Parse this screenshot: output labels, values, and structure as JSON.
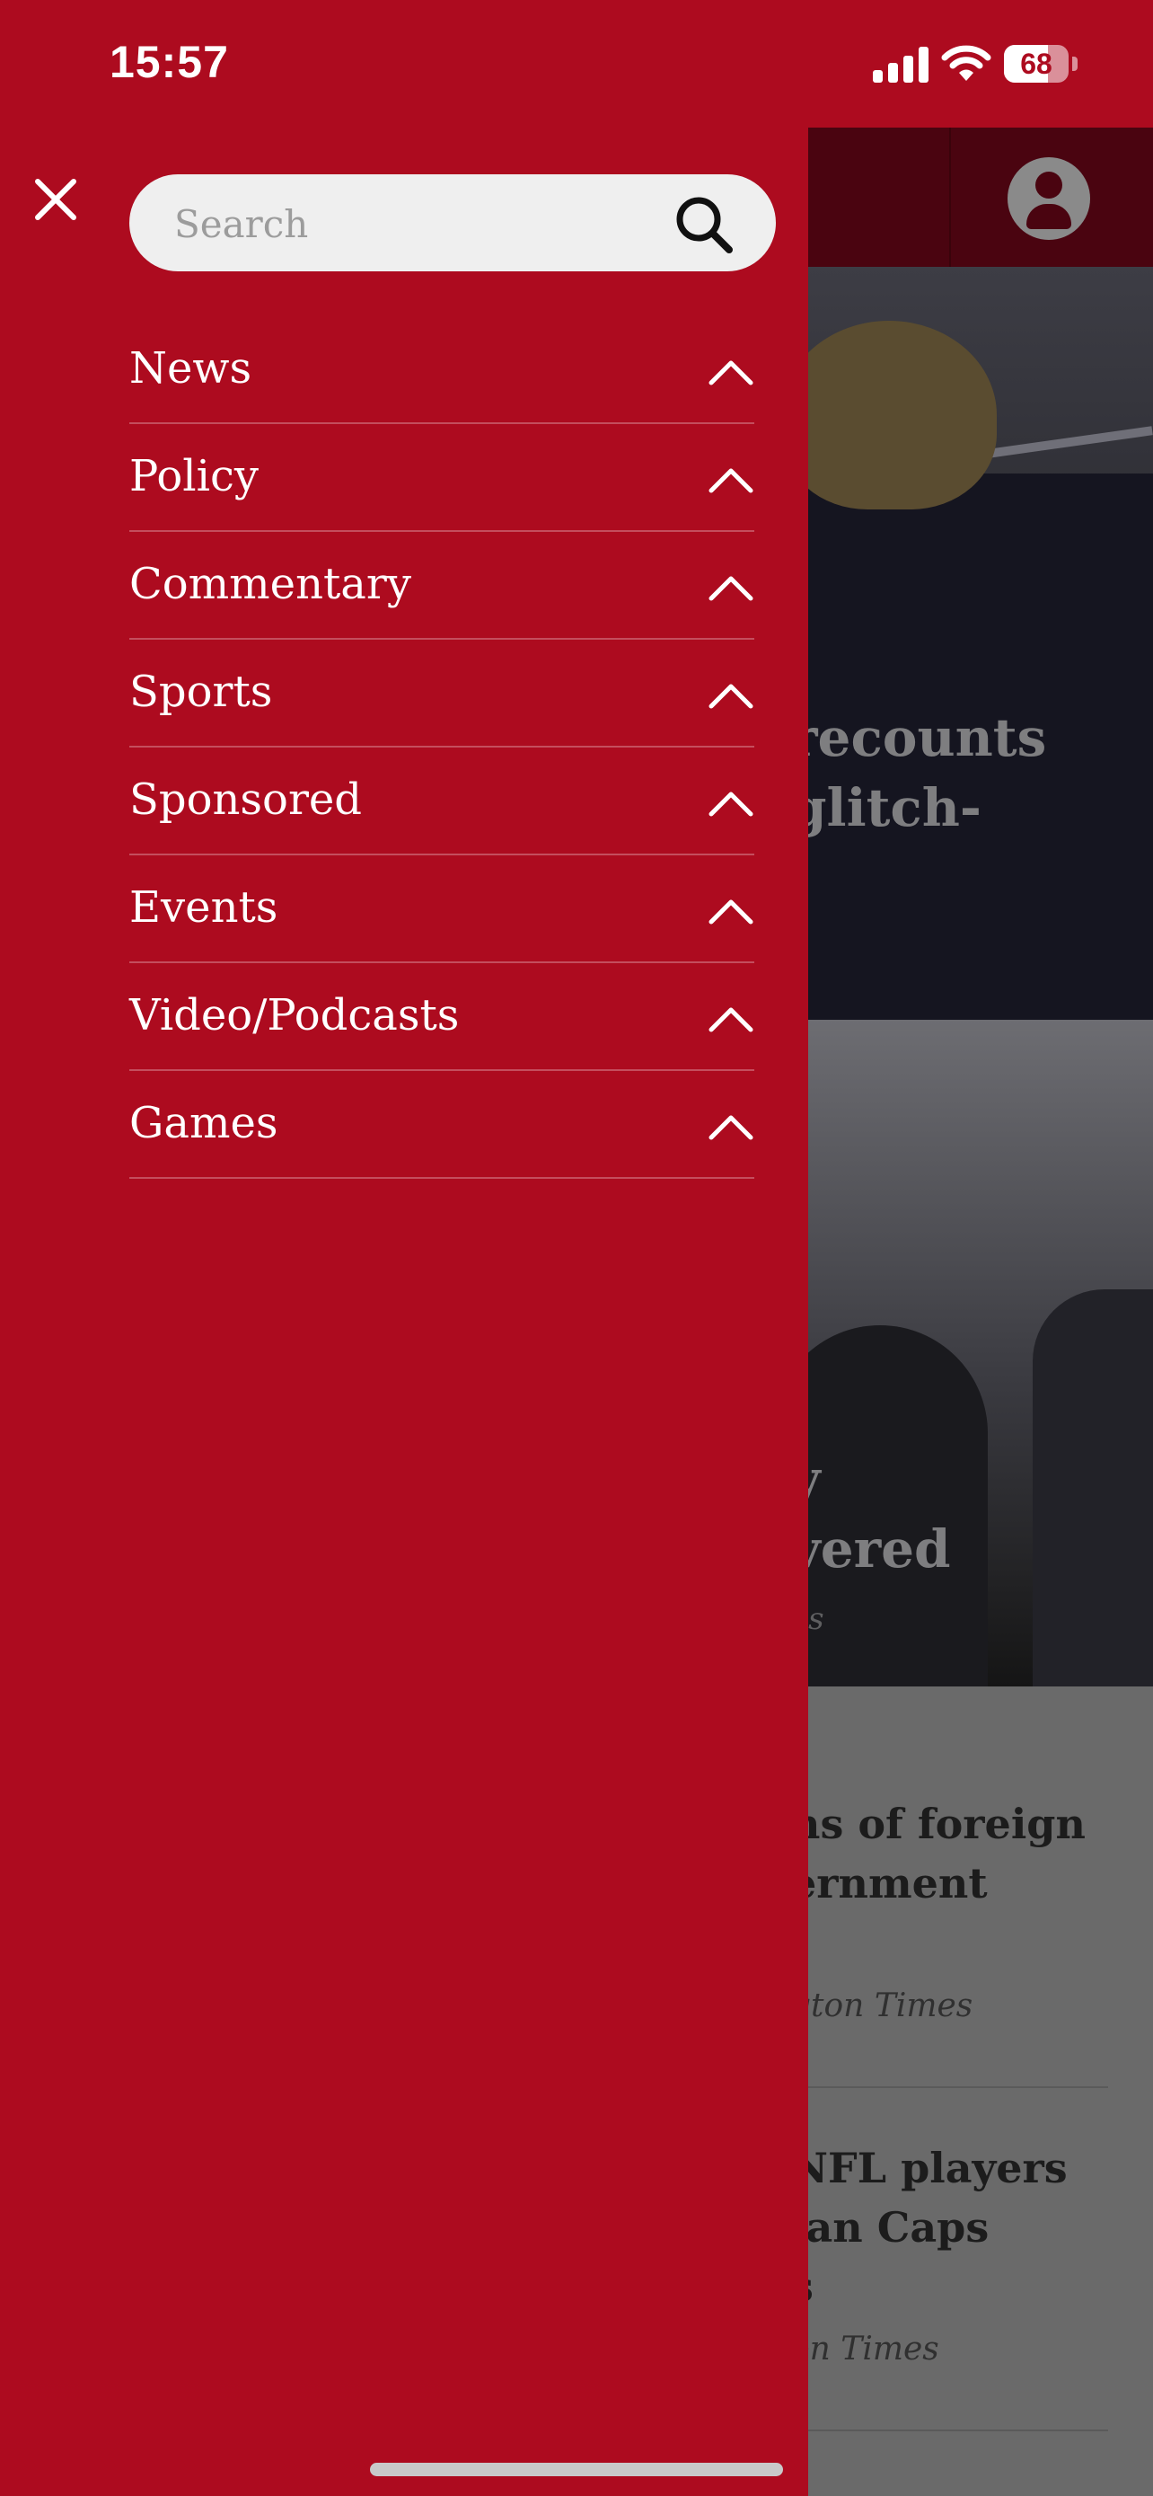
{
  "status_bar": {
    "time": "15:57",
    "battery_percent": "68",
    "battery_level": 0.68
  },
  "colors": {
    "brand": "#ad0b1f",
    "search_bg": "#efefef",
    "text_on_brand": "#ffffff"
  },
  "drawer": {
    "close_icon": "close-icon",
    "search": {
      "placeholder": "Search",
      "value": "",
      "icon": "search-icon"
    },
    "menu_items": [
      {
        "label": "News",
        "icon": "chevron-up-icon"
      },
      {
        "label": "Policy",
        "icon": "chevron-up-icon"
      },
      {
        "label": "Commentary",
        "icon": "chevron-up-icon"
      },
      {
        "label": "Sports",
        "icon": "chevron-up-icon"
      },
      {
        "label": "Sponsored",
        "icon": "chevron-up-icon"
      },
      {
        "label": "Events",
        "icon": "chevron-up-icon"
      },
      {
        "label": "Video/Podcasts",
        "icon": "chevron-up-icon"
      },
      {
        "label": "Games",
        "icon": "chevron-up-icon"
      }
    ]
  },
  "background_app": {
    "account_icon": "account-icon",
    "hero_1_headline": [
      "recounts",
      "glitch-"
    ],
    "hero_2_headline": [
      "y",
      "vered"
    ],
    "hero_2_source": "es",
    "stories": [
      {
        "title": "ns of foreign\nernment",
        "source": "gton Times"
      },
      {
        "title": "NFL players\nian Caps\ns",
        "source": "on Times"
      }
    ]
  }
}
